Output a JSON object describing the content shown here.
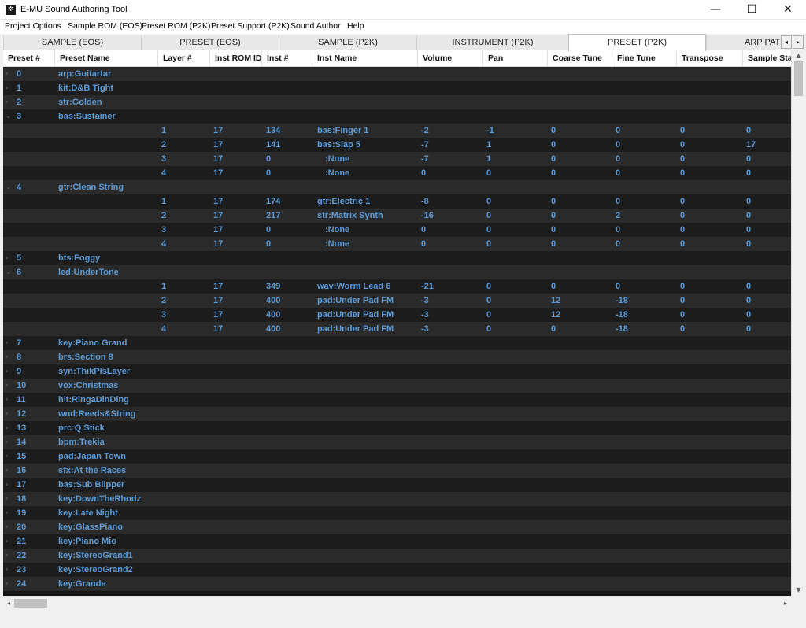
{
  "window": {
    "title": "E-MU Sound Authoring Tool",
    "icon": "emu-logo-icon",
    "minimize_glyph": "—",
    "maximize_glyph": "☐",
    "close_glyph": "✕"
  },
  "menu": [
    "Project Options",
    "Sample ROM (EOS)",
    "Preset ROM (P2K)",
    "Preset Support (P2K)",
    "Sound Author",
    "Help"
  ],
  "tabs": [
    {
      "label": "SAMPLE (EOS)"
    },
    {
      "label": "PRESET (EOS)"
    },
    {
      "label": "SAMPLE (P2K)"
    },
    {
      "label": "INSTRUMENT (P2K)"
    },
    {
      "label": "PRESET (P2K)",
      "active": true
    },
    {
      "label": "ARP PAT"
    }
  ],
  "tab_scroll": {
    "left": "◂",
    "right": "▸"
  },
  "columns": [
    "Preset #",
    "Preset Name",
    "Layer #",
    "Inst ROM ID",
    "Inst #",
    "Inst Name",
    "Volume",
    "Pan",
    "Coarse Tune",
    "Fine Tune",
    "Transpose",
    "Sample Start"
  ],
  "glyphs": {
    "collapsed": "›",
    "expanded": "⌄",
    "up": "▲",
    "down": "▼",
    "left": "◂",
    "right": "▸"
  },
  "rows": [
    {
      "preset": "0",
      "name": "arp:Guitartar",
      "expander": "›"
    },
    {
      "preset": "1",
      "name": "kit:D&B Tight",
      "expander": "›"
    },
    {
      "preset": "2",
      "name": "str:Golden",
      "expander": "›"
    },
    {
      "preset": "3",
      "name": "bas:Sustainer",
      "expander": "⌄"
    },
    {
      "layer": "1",
      "rom": "17",
      "inst": "134",
      "instname": "bas:Finger 1",
      "vol": "-2",
      "pan": "-1",
      "coarse": "0",
      "fine": "0",
      "transpose": "0",
      "start": "0"
    },
    {
      "layer": "2",
      "rom": "17",
      "inst": "141",
      "instname": "bas:Slap 5",
      "vol": "-7",
      "pan": "1",
      "coarse": "0",
      "fine": "0",
      "transpose": "0",
      "start": "17"
    },
    {
      "layer": "3",
      "rom": "17",
      "inst": "0",
      "instname": ":None",
      "indent": true,
      "vol": "-7",
      "pan": "1",
      "coarse": "0",
      "fine": "0",
      "transpose": "0",
      "start": "0"
    },
    {
      "layer": "4",
      "rom": "17",
      "inst": "0",
      "instname": ":None",
      "indent": true,
      "vol": "0",
      "pan": "0",
      "coarse": "0",
      "fine": "0",
      "transpose": "0",
      "start": "0"
    },
    {
      "preset": "4",
      "name": "gtr:Clean String",
      "expander": "⌄"
    },
    {
      "layer": "1",
      "rom": "17",
      "inst": "174",
      "instname": "gtr:Electric 1",
      "vol": "-8",
      "pan": "0",
      "coarse": "0",
      "fine": "0",
      "transpose": "0",
      "start": "0"
    },
    {
      "layer": "2",
      "rom": "17",
      "inst": "217",
      "instname": "str:Matrix Synth",
      "vol": "-16",
      "pan": "0",
      "coarse": "0",
      "fine": "2",
      "transpose": "0",
      "start": "0"
    },
    {
      "layer": "3",
      "rom": "17",
      "inst": "0",
      "instname": ":None",
      "indent": true,
      "vol": "0",
      "pan": "0",
      "coarse": "0",
      "fine": "0",
      "transpose": "0",
      "start": "0"
    },
    {
      "layer": "4",
      "rom": "17",
      "inst": "0",
      "instname": ":None",
      "indent": true,
      "vol": "0",
      "pan": "0",
      "coarse": "0",
      "fine": "0",
      "transpose": "0",
      "start": "0"
    },
    {
      "preset": "5",
      "name": "bts:Foggy",
      "expander": "›"
    },
    {
      "preset": "6",
      "name": "led:UnderTone",
      "expander": "⌄"
    },
    {
      "layer": "1",
      "rom": "17",
      "inst": "349",
      "instname": "wav:Worm Lead 6",
      "vol": "-21",
      "pan": "0",
      "coarse": "0",
      "fine": "0",
      "transpose": "0",
      "start": "0"
    },
    {
      "layer": "2",
      "rom": "17",
      "inst": "400",
      "instname": "pad:Under Pad FM",
      "vol": "-3",
      "pan": "0",
      "coarse": "12",
      "fine": "-18",
      "transpose": "0",
      "start": "0"
    },
    {
      "layer": "3",
      "rom": "17",
      "inst": "400",
      "instname": "pad:Under Pad FM",
      "vol": "-3",
      "pan": "0",
      "coarse": "12",
      "fine": "-18",
      "transpose": "0",
      "start": "0"
    },
    {
      "layer": "4",
      "rom": "17",
      "inst": "400",
      "instname": "pad:Under Pad FM",
      "vol": "-3",
      "pan": "0",
      "coarse": "0",
      "fine": "-18",
      "transpose": "0",
      "start": "0"
    },
    {
      "preset": "7",
      "name": "key:Piano Grand",
      "expander": "›"
    },
    {
      "preset": "8",
      "name": "brs:Section 8",
      "expander": "›"
    },
    {
      "preset": "9",
      "name": "syn:ThikPlsLayer",
      "expander": "›"
    },
    {
      "preset": "10",
      "name": "vox:Christmas",
      "expander": "›"
    },
    {
      "preset": "11",
      "name": "hit:RingaDinDing",
      "expander": "›"
    },
    {
      "preset": "12",
      "name": "wnd:Reeds&String",
      "expander": "›"
    },
    {
      "preset": "13",
      "name": "prc:Q Stick",
      "expander": "›"
    },
    {
      "preset": "14",
      "name": "bpm:Trekia",
      "expander": "›"
    },
    {
      "preset": "15",
      "name": "pad:Japan Town",
      "expander": "›"
    },
    {
      "preset": "16",
      "name": "sfx:At the Races",
      "expander": "›"
    },
    {
      "preset": "17",
      "name": "bas:Sub Blipper",
      "expander": "›"
    },
    {
      "preset": "18",
      "name": "key:DownTheRhodz",
      "expander": "›"
    },
    {
      "preset": "19",
      "name": "key:Late Night",
      "expander": "›"
    },
    {
      "preset": "20",
      "name": "key:GlassPiano",
      "expander": "›"
    },
    {
      "preset": "21",
      "name": "key:Piano Mio",
      "expander": "›"
    },
    {
      "preset": "22",
      "name": "key:StereoGrand1",
      "expander": "›"
    },
    {
      "preset": "23",
      "name": "key:StereoGrand2",
      "expander": "›"
    },
    {
      "preset": "24",
      "name": "key:Grande",
      "expander": "›"
    }
  ],
  "colors": {
    "row_text": "#5b9bd8",
    "row_odd": "#2a2a2a",
    "row_even": "#1c1c1c"
  }
}
